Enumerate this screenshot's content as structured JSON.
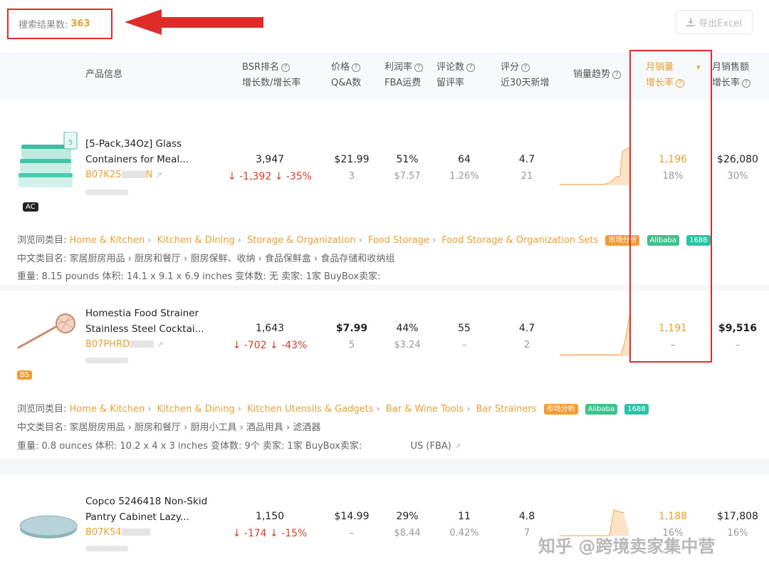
{
  "top": {
    "result_label": "搜索结果数:",
    "result_count": "363",
    "export_label": "导出Excel"
  },
  "header": {
    "product_info": "产品信息",
    "bsr_line1": "BSR排名",
    "bsr_line2": "增长数/增长率",
    "price_line1": "价格",
    "price_line2": "Q&A数",
    "profit_line1": "利润率",
    "profit_line2": "FBA运费",
    "reviews_line1": "评论数",
    "reviews_line2": "留评率",
    "rating_line1": "评分",
    "rating_line2": "近30天新增",
    "trend": "销量趋势",
    "monthly_sales_line1": "月销量",
    "monthly_sales_line2": "增长率",
    "monthly_revenue_line1": "月销售额",
    "monthly_revenue_line2": "增长率"
  },
  "rows": [
    {
      "title_line1": "[5-Pack,34Oz] Glass",
      "title_line2": "Containers for Meal...",
      "asin": "B07K25",
      "asin_tail": "N",
      "badge": "AC",
      "bsr": "3,947",
      "bsr_change": "↓ -1,392  ↓ -35%",
      "price": "$21.99",
      "qa": "3",
      "profit": "51%",
      "fba": "$7.57",
      "reviews": "64",
      "review_rate": "1.26%",
      "rating": "4.7",
      "new_ratings": "21",
      "monthly_sales": "1,196",
      "sales_growth": "18%",
      "revenue": "$26,080",
      "revenue_growth": "30%",
      "browse_label": "浏览同类目:",
      "categories": [
        "Home & Kitchen",
        "Kitchen & Dining",
        "Storage & Organization",
        "Food Storage",
        "Food Storage & Organization Sets"
      ],
      "cn_label": "中文类目名:",
      "cn_categories": "家居厨房用品 ›  厨房和餐厅 ›  厨房保鲜、收纳 ›  食品保鲜盒 ›  食品存储和收纳组",
      "meta": "重量: 8.15 pounds     体积: 14.1 x 9.1 x 6.9 inches     变体数: 无     卖家: 1家     BuyBox卖家:"
    },
    {
      "title_line1": "Homestia Food Strainer",
      "title_line2": "Stainless Steel Cocktai...",
      "asin": "B07PHRD",
      "asin_tail": "",
      "badge": "BS",
      "bsr": "1,643",
      "bsr_change": "↓ -702  ↓ -43%",
      "price": "$7.99",
      "qa": "5",
      "profit": "44%",
      "fba": "$3.24",
      "reviews": "55",
      "review_rate": "–",
      "rating": "4.7",
      "new_ratings": "2",
      "monthly_sales": "1,191",
      "sales_growth": "–",
      "revenue": "$9,516",
      "revenue_growth": "–",
      "browse_label": "浏览同类目:",
      "categories": [
        "Home & Kitchen",
        "Kitchen & Dining",
        "Kitchen Utensils & Gadgets",
        "Bar & Wine Tools",
        "Bar Strainers"
      ],
      "cn_label": "中文类目名:",
      "cn_categories": "家居厨房用品 ›  厨房和餐厅 ›  厨用小工具 ›  酒品用具 ›  滤酒器",
      "meta": "重量: 0.8 ounces     体积: 10.2 x 4 x 3 inches     变体数: 9个     卖家: 1家     BuyBox卖家:",
      "buybox_tail": "US (FBA)"
    },
    {
      "title_line1": "Copco 5246418 Non-Skid",
      "title_line2": "Pantry Cabinet Lazy...",
      "asin": "B07K54",
      "asin_tail": "",
      "bsr": "1,150",
      "bsr_change": "↓ -174  ↓ -15%",
      "price": "$14.99",
      "qa": "–",
      "profit": "29%",
      "fba": "$8.44",
      "reviews": "11",
      "review_rate": "0.42%",
      "rating": "4.8",
      "new_ratings": "7",
      "monthly_sales": "1,188",
      "sales_growth": "16%",
      "revenue": "$17,808",
      "revenue_growth": "16%"
    }
  ],
  "tags": {
    "market": "市场分析",
    "alibaba": "Alibaba",
    "t1688": "1688"
  },
  "watermark": "知乎 @跨境卖家集中营"
}
